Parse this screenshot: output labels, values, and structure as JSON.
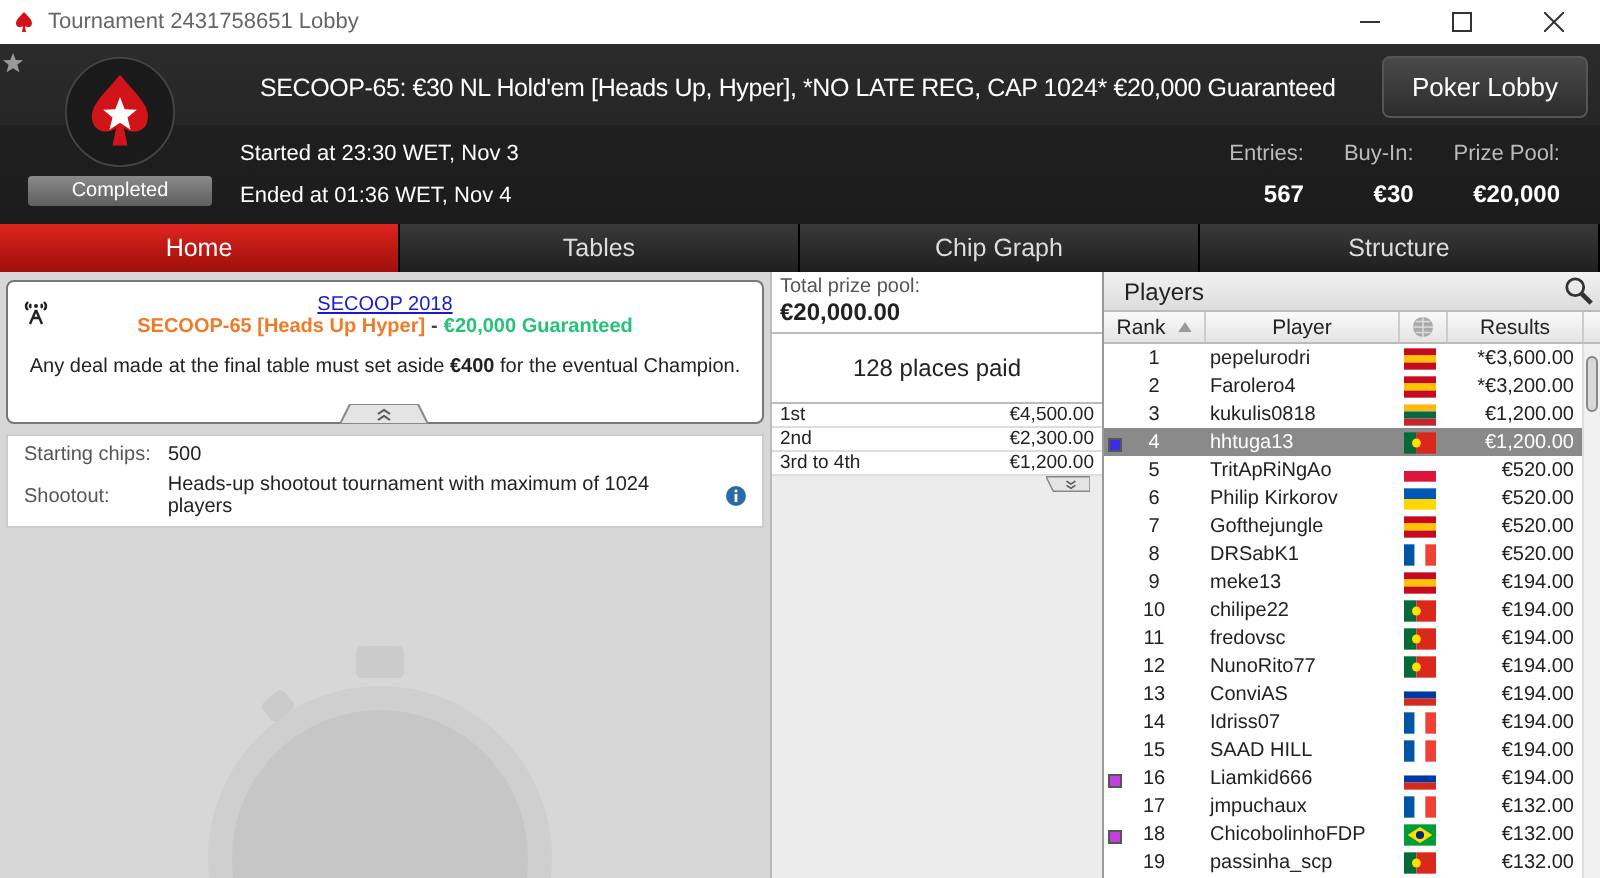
{
  "window": {
    "title": "Tournament 2431758651 Lobby"
  },
  "header": {
    "title": "SECOOP-65: €30 NL Hold'em [Heads Up, Hyper], *NO LATE REG, CAP 1024* €20,000 Guaranteed",
    "status": "Completed",
    "started": "Started at 23:30 WET, Nov 3",
    "ended": "Ended at 01:36 WET, Nov 4",
    "lobby_button": "Poker Lobby",
    "stats": [
      {
        "label": "Entries:",
        "value": "567"
      },
      {
        "label": "Buy-In:",
        "value": "€30"
      },
      {
        "label": "Prize Pool:",
        "value": "€20,000"
      }
    ]
  },
  "tabs": [
    {
      "label": "Home",
      "selected": true
    },
    {
      "label": "Tables",
      "selected": false
    },
    {
      "label": "Chip Graph",
      "selected": false
    },
    {
      "label": "Structure",
      "selected": false
    }
  ],
  "notice": {
    "link": "SECOOP 2018",
    "event": "SECOOP-65 [Heads Up Hyper]",
    "separator": "-",
    "guarantee": "€20,000 Guaranteed",
    "message": "Any deal made at the final table must set aside **€400** for the eventual Champion."
  },
  "details": [
    {
      "label": "Starting chips:",
      "value": "500",
      "info": false
    },
    {
      "label": "Shootout:",
      "value": "Heads-up shootout tournament with maximum of 1024 players",
      "info": true
    }
  ],
  "prizes": {
    "total_label": "Total prize pool:",
    "total": "€20,000.00",
    "places": "128 places paid",
    "payouts": [
      {
        "place": "1st",
        "amount": "€4,500.00"
      },
      {
        "place": "2nd",
        "amount": "€2,300.00"
      },
      {
        "place": "3rd to 4th",
        "amount": "€1,200.00"
      }
    ]
  },
  "players": {
    "title": "Players",
    "columns": [
      "Rank",
      "Player",
      "Results"
    ],
    "rows": [
      {
        "rank": "1",
        "name": "pepelurodri",
        "kind": "es",
        "result": "*€3,600.00",
        "selected": false
      },
      {
        "rank": "2",
        "name": "Farolero4",
        "kind": "es",
        "result": "*€3,200.00",
        "selected": false
      },
      {
        "rank": "3",
        "name": "kukulis0818",
        "kind": "lt",
        "result": "€1,200.00",
        "selected": false
      },
      {
        "rank": "4",
        "name": "hhtuga13",
        "kind": "pt",
        "result": "€1,200.00",
        "selected": true,
        "color": "#3a2ee0"
      },
      {
        "rank": "5",
        "name": "TritApRiNgAo",
        "kind": "pl",
        "result": "€520.00",
        "selected": false
      },
      {
        "rank": "6",
        "name": "Philip Kirkorov",
        "kind": "ua",
        "result": "€520.00",
        "selected": false
      },
      {
        "rank": "7",
        "name": "Gofthejungle",
        "kind": "es",
        "result": "€520.00",
        "selected": false
      },
      {
        "rank": "8",
        "name": "DRSabK1",
        "kind": "fr",
        "result": "€520.00",
        "selected": false
      },
      {
        "rank": "9",
        "name": "meke13",
        "kind": "es",
        "result": "€194.00",
        "selected": false
      },
      {
        "rank": "10",
        "name": "chilipe22",
        "kind": "pt",
        "result": "€194.00",
        "selected": false
      },
      {
        "rank": "11",
        "name": "fredovsc",
        "kind": "pt",
        "result": "€194.00",
        "selected": false
      },
      {
        "rank": "12",
        "name": "NunoRito77",
        "kind": "pt",
        "result": "€194.00",
        "selected": false
      },
      {
        "rank": "13",
        "name": "ConviAS",
        "kind": "ru",
        "result": "€194.00",
        "selected": false
      },
      {
        "rank": "14",
        "name": "Idriss07",
        "kind": "fr",
        "result": "€194.00",
        "selected": false
      },
      {
        "rank": "15",
        "name": "SAAD HILL",
        "kind": "fr",
        "result": "€194.00",
        "selected": false
      },
      {
        "rank": "16",
        "name": "Liamkid666",
        "kind": "ru",
        "result": "€194.00",
        "selected": false,
        "color": "#c040e0"
      },
      {
        "rank": "17",
        "name": "jmpuchaux",
        "kind": "fr",
        "result": "€132.00",
        "selected": false
      },
      {
        "rank": "18",
        "name": "ChicobolinhoFDP",
        "kind": "br",
        "result": "€132.00",
        "selected": false,
        "color": "#c040e0"
      },
      {
        "rank": "19",
        "name": "passinha_scp",
        "kind": "pt",
        "result": "€132.00",
        "selected": false
      }
    ]
  }
}
